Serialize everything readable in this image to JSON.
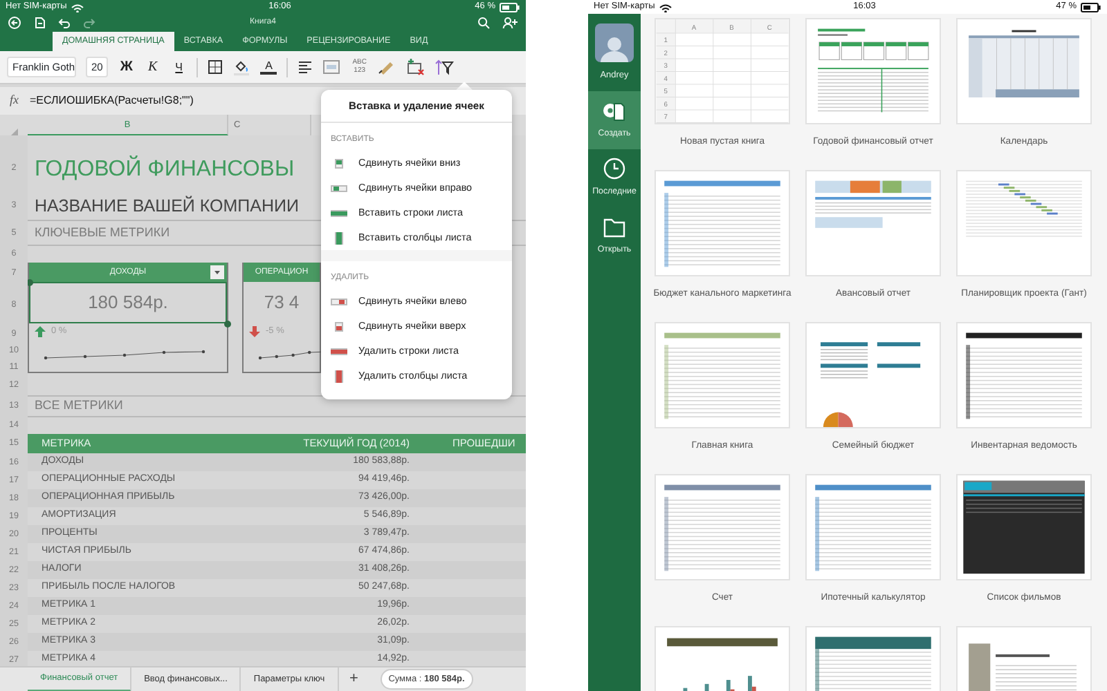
{
  "left": {
    "status_bar": {
      "carrier": "Нет SIM-карты",
      "time": "16:06",
      "battery": "46 %"
    },
    "title": "Книга4",
    "tabs": [
      {
        "label": "ДОМАШНЯЯ СТРАНИЦА",
        "selected": true
      },
      {
        "label": "ВСТАВКА",
        "selected": false
      },
      {
        "label": "ФОРМУЛЫ",
        "selected": false
      },
      {
        "label": "РЕЦЕНЗИРОВАНИЕ",
        "selected": false
      },
      {
        "label": "ВИД",
        "selected": false
      }
    ],
    "toolbar": {
      "font": "Franklin Goth",
      "size": "20",
      "bold": "Ж",
      "italic": "К",
      "underline": "Ч",
      "font_color": "A",
      "number_format": "ABC 123"
    },
    "formula_bar": {
      "label": "fx",
      "value": "=ЕСЛИОШИБКА(Расчеты!G8;\"\")"
    },
    "columns": [
      {
        "label": "B",
        "selected": true
      },
      {
        "label": "C",
        "selected": false
      }
    ],
    "sheet": {
      "row_numbers": [
        "2",
        "3",
        "5",
        "6",
        "7",
        "8",
        "9",
        "10",
        "11",
        "12",
        "13",
        "14",
        "15",
        "16",
        "17",
        "18",
        "19",
        "20",
        "21",
        "22",
        "23",
        "24",
        "25",
        "26",
        "27"
      ],
      "title": "ГОДОВОЙ ФИНАНСОВЫ",
      "company": "НАЗВАНИЕ ВАШЕЙ КОМПАНИИ",
      "key_metrics": "КЛЮЧЕВЫЕ МЕТРИКИ",
      "kpis": [
        {
          "label": "ДОХОДЫ",
          "value": "180 584р.",
          "change": "0 %",
          "kind": "up",
          "selected": true
        },
        {
          "label": "ОПЕРАЦИОН",
          "value": "73 4",
          "change": "-5 %",
          "kind": "down",
          "selected": false
        }
      ],
      "all_metrics": "ВСЕ МЕТРИКИ",
      "table": {
        "columns": [
          "МЕТРИКА",
          "ТЕКУЩИЙ ГОД (2014)",
          "ПРОШЕДШИ"
        ],
        "rows": [
          [
            "ДОХОДЫ",
            "180 583,88р."
          ],
          [
            "ОПЕРАЦИОННЫЕ РАСХОДЫ",
            "94 419,46р."
          ],
          [
            "ОПЕРАЦИОННАЯ ПРИБЫЛЬ",
            "73 426,00р."
          ],
          [
            "АМОРТИЗАЦИЯ",
            "5 546,89р."
          ],
          [
            "ПРОЦЕНТЫ",
            "3 789,47р."
          ],
          [
            "ЧИСТАЯ ПРИБЫЛЬ",
            "67 474,86р."
          ],
          [
            "НАЛОГИ",
            "31 408,26р."
          ],
          [
            "ПРИБЫЛЬ ПОСЛЕ НАЛОГОВ",
            "50 247,68р."
          ],
          [
            "МЕТРИКА 1",
            "19,96р."
          ],
          [
            "МЕТРИКА 2",
            "26,02р."
          ],
          [
            "МЕТРИКА 3",
            "31,09р."
          ],
          [
            "МЕТРИКА 4",
            "14,92р."
          ]
        ]
      }
    },
    "sheet_tabs": [
      {
        "label": "Финансовый отчет",
        "selected": true
      },
      {
        "label": "Ввод финансовых...",
        "selected": false
      },
      {
        "label": "Параметры ключ",
        "selected": false
      }
    ],
    "add_sheet": "+",
    "sum": "Сумма : **180 584р.**",
    "popover": {
      "title": "Вставка и удаление ячеек",
      "sections": [
        {
          "header": "ВСТАВИТЬ",
          "kind": "insert",
          "items": [
            {
              "label": "Сдвинуть ячейки вниз",
              "kind": "cells-down"
            },
            {
              "label": "Сдвинуть ячейки вправо",
              "kind": "cells-right"
            },
            {
              "label": "Вставить строки листа",
              "kind": "rows"
            },
            {
              "label": "Вставить столбцы листа",
              "kind": "columns"
            }
          ]
        },
        {
          "header": "УДАЛИТЬ",
          "kind": "delete",
          "items": [
            {
              "label": "Сдвинуть ячейки влево",
              "kind": "cells-left"
            },
            {
              "label": "Сдвинуть ячейки вверх",
              "kind": "cells-up"
            },
            {
              "label": "Удалить строки листа",
              "kind": "rows"
            },
            {
              "label": "Удалить столбцы листа",
              "kind": "columns"
            }
          ]
        }
      ]
    }
  },
  "right": {
    "status_bar": {
      "carrier": "Нет SIM-карты",
      "time": "16:03",
      "battery": "47 %"
    },
    "sidebar": {
      "user": "Andrey",
      "items": [
        {
          "label": "Создать",
          "kind": "new",
          "selected": true
        },
        {
          "label": "Последние",
          "kind": "recent",
          "selected": false
        },
        {
          "label": "Открыть",
          "kind": "open",
          "selected": false
        }
      ]
    },
    "templates": [
      {
        "label": "Новая пустая книга",
        "kind": "blank",
        "columns": [
          "A",
          "B",
          "C"
        ],
        "rows": [
          "1",
          "2",
          "3",
          "4",
          "5",
          "6",
          "7"
        ]
      },
      {
        "label": "Годовой финансовый отчет",
        "kind": "report"
      },
      {
        "label": "Календарь",
        "kind": "calendar"
      },
      {
        "label": "Бюджет канального маркетинга",
        "kind": "budget"
      },
      {
        "label": "Авансовый отчет",
        "kind": "advance"
      },
      {
        "label": "Планировщик проекта (Гант)",
        "kind": "gantt"
      },
      {
        "label": "Главная книга",
        "kind": "ledger"
      },
      {
        "label": "Семейный бюджет",
        "kind": "family"
      },
      {
        "label": "Инвентарная ведомость",
        "kind": "inventory"
      },
      {
        "label": "Счет",
        "kind": "invoice"
      },
      {
        "label": "Ипотечный калькулятор",
        "kind": "mortgage"
      },
      {
        "label": "Список фильмов",
        "kind": "movies"
      },
      {
        "kind": "chart"
      },
      {
        "kind": "teal"
      },
      {
        "kind": "tracker"
      }
    ]
  }
}
